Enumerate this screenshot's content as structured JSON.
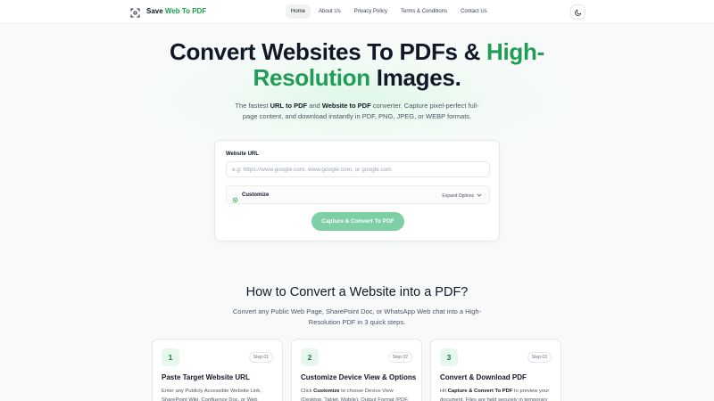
{
  "nav": {
    "logo_text_a": "Save ",
    "logo_text_b": "Web To",
    "logo_text_c": " PDF",
    "links": [
      "Home",
      "About Us",
      "Privacy Policy",
      "Terms & Conditions",
      "Contact Us"
    ],
    "active_index": 0
  },
  "hero": {
    "title_a": "Convert Websites To PDFs & ",
    "title_b": "High-Resolution",
    "title_c": " Images.",
    "sub_a": "The fastest ",
    "sub_b": "URL to PDF",
    "sub_c": " and ",
    "sub_d": "Website to PDF",
    "sub_e": " converter. Capture pixel-perfect full-page content, and download instantly in PDF, PNG, JPEG, or WEBP formats."
  },
  "form": {
    "url_label": "Website URL",
    "url_value": "",
    "url_placeholder": "e.g. https://www.google.com, www.google.com, or google.com",
    "customize_label": "Customize",
    "expand_label": "Expand Options",
    "cta_label": "Capture & Convert To PDF"
  },
  "how": {
    "title": "How to Convert a Website into a PDF?",
    "subtitle": "Convert any Public Web Page, SharePoint Doc, or WhatsApp Web chat into a High-Resolution PDF in 3 quick steps.",
    "steps": [
      {
        "num": "1",
        "tag": "Step 01",
        "title": "Paste Target Website URL",
        "desc_a": "Enter any Publicly Accessible Website Link, SharePoint Wiki, Confluence Doc, or Web",
        "desc_b": "",
        "desc_c": ""
      },
      {
        "num": "2",
        "tag": "Step 02",
        "title": "Customize Device View & Options",
        "desc_a": "Click ",
        "desc_b": "Customize",
        "desc_c": " to choose Device View (Desktop, Tablet, Mobile), Output Format (PDF,"
      },
      {
        "num": "3",
        "tag": "Step 03",
        "title": "Convert & Download PDF",
        "desc_a": "Hit ",
        "desc_b": "Capture & Convert To PDF",
        "desc_c": " to preview your document. Files are held securely in temporary"
      }
    ]
  },
  "colors": {
    "accent": "#1f9d55",
    "cta": "#7fcfa6",
    "step_badge_bg": "#e8f7ee"
  },
  "icons": [
    "scan-icon",
    "moon-icon",
    "gear-icon",
    "chevron-down-icon"
  ]
}
